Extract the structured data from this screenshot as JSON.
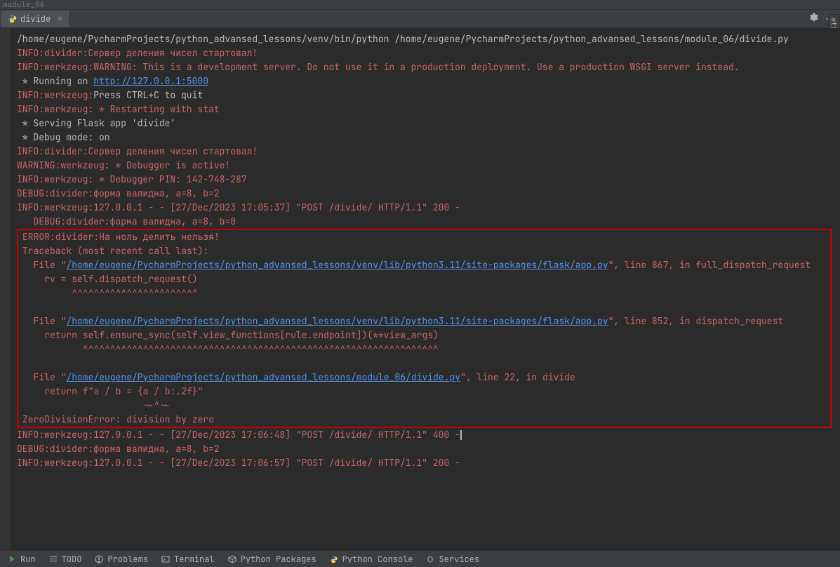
{
  "top_bar": "module_06",
  "tab": {
    "label": "divide"
  },
  "side_tab": "ations",
  "console": {
    "cmd_line": "/home/eugene/PycharmProjects/python_advansed_lessons/venv/bin/python /home/eugene/PycharmProjects/python_advansed_lessons/module_06/divide.py",
    "line2_prefix": "INFO:divider:",
    "line2_text": "Сервер деления чисел стартовал!",
    "line3_prefix": "INFO:werkzeug:",
    "line3_text": "WARNING: This is a development server. Do not use it in a production deployment. Use a production WSGI server instead.",
    "line4_prefix": " * Running on ",
    "line4_link": "http://127.0.0.1:5000",
    "line5_prefix": "INFO:werkzeug:",
    "line5_text": "Press CTRL+C to quit",
    "line6": "INFO:werkzeug: * Restarting with stat",
    "line7": " * Serving Flask app 'divide'",
    "line8": " * Debug mode: on",
    "line9_prefix": "INFO:divider:",
    "line9_text": "Сервер деления чисел стартовал!",
    "line10": "WARNING:werkzeug: * Debugger is active!",
    "line11": "INFO:werkzeug: * Debugger PIN: 142-748-287",
    "line12": "DEBUG:divider:форма валидна, a=8, b=2",
    "line13": "INFO:werkzeug:127.0.0.1 - - [27/Dec/2023 17:05:37] \"POST /divide/ HTTP/1.1\" 200 -",
    "line14": "   DEBUG:divider:форма валидна, a=8, b=0",
    "error": {
      "line1": "ERROR:divider:На ноль делить нельзя!",
      "line2": "Traceback (most recent call last):",
      "file1_pre": "  File \"",
      "file1_link": "/home/eugene/PycharmProjects/python_advansed_lessons/venv/lib/python3.11/site-packages/flask/app.py",
      "file1_post": "\", line 867, in full_dispatch_request",
      "code1": "    rv = self.dispatch_request()",
      "carets1": "         ^^^^^^^^^^^^^^^^^^^^^^^",
      "file2_pre": "  File \"",
      "file2_link": "/home/eugene/PycharmProjects/python_advansed_lessons/venv/lib/python3.11/site-packages/flask/app.py",
      "file2_post": "\", line 852, in dispatch_request",
      "code2": "    return self.ensure_sync(self.view_functions[rule.endpoint])(**view_args)",
      "carets2": "           ^^^^^^^^^^^^^^^^^^^^^^^^^^^^^^^^^^^^^^^^^^^^^^^^^^^^^^^^^^^^^^^^^",
      "file3_pre": "  File \"",
      "file3_link": "/home/eugene/PycharmProjects/python_advansed_lessons/module_06/divide.py",
      "file3_post": "\", line 22, in divide",
      "code3": "    return f\"a / b = {a / b:.2f}\"",
      "tilde": "                      ~~^~~",
      "zerodiv": "ZeroDivisionError: division by zero"
    },
    "line_after1": "INFO:werkzeug:127.0.0.1 - - [27/Dec/2023 17:06:48] \"POST /divide/ HTTP/1.1\" 400 -",
    "line_after2": "DEBUG:divider:форма валидна, a=8, b=2",
    "line_after3": "INFO:werkzeug:127.0.0.1 - - [27/Dec/2023 17:06:57] \"POST /divide/ HTTP/1.1\" 200 -"
  },
  "status_bar": {
    "run": "Run",
    "todo": "TODO",
    "problems": "Problems",
    "terminal": "Terminal",
    "packages": "Python Packages",
    "console": "Python Console",
    "services": "Services"
  }
}
